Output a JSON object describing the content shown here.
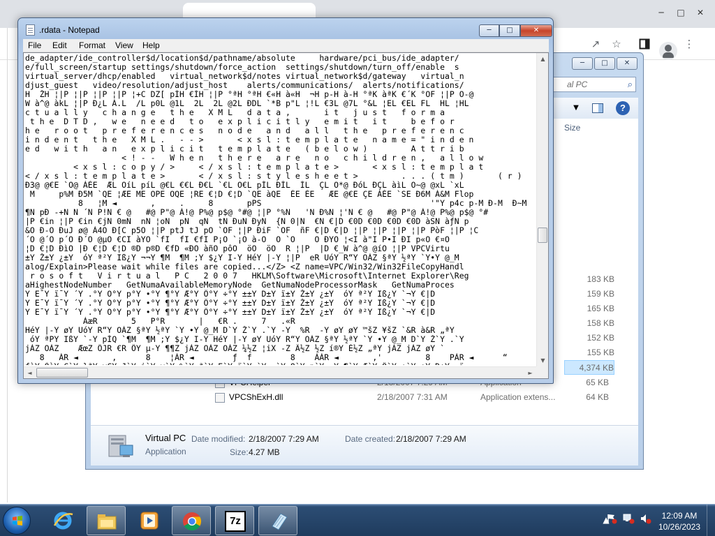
{
  "notepad": {
    "title": ".rdata - Notepad",
    "controls": {
      "minimize": "─",
      "maximize": "□",
      "close": "✕"
    },
    "menu": [
      "File",
      "Edit",
      "Format",
      "View",
      "Help"
    ],
    "lines": [
      "de_adapter/ide_controller$d/location$d/pathname/absolute     hardware/pci_bus/ide_adapter/",
      "e/full_screen/startup settings/shutdown/force_action  settings/shutdown/turn_off/enable  s",
      "virtual_server/dhcp/enabled   virtual_network$d/notes virtual_network$d/gateway   virtual_n",
      "djust_guest   video/resolution/adjust_host    alerts/communications/  alerts/notifications/",
      "H  ŽH ¦|P ¦|P ¦|P ¦|P ¦+C DZ[ pÍH €ÍH ¦|P °ªH °ªH €«H à«H  ¬H p-H à-H °ªK àªK €´K °OF ¦|P O-@",
      "W à^@ àkL ¦|P Đ¿L À.L  /L p0L @1L  2L  2L @2L ĐDL `*B p\"L ¦!L €3L @7L °&L ¦EL €EL FL  HL ¦HL",
      "c t u a l l y   c h a n g e   t h e   X M L   d a t a ,       i t   j u s t   f o r m a",
      " t h e  D T D ,   w e   n e e d   t o   e x p l i c i t l y   e m i t   i t     b e f o r",
      "h e   r o o t   p r e f e r e n c e s   n o d e   a n d   a l l   t h e   p r e f e r e n c",
      "i n d e n t   t h e   X M L .   - - >       < x s l : t e m p l a t e   n a m e = \" i n d e n",
      "e d   w i t h   a n   e x p l i c i t   t e m p l a t e   ( b e l o w )         A t t r i b",
      "                    < ! - -   W h e n   t h e r e   a r e   n o   c h i l d r e n ,   a l l o w",
      "          < x s l : c o p y / >     < / x s l : t e m p l a t e >       < x s l : t e m p l a t",
      "< / x s l : t e m p l a t e >       < / x s l : s t y l e s h e e t >         . . . ( t m )       ( r )   (",
      "Đ3@ @€E `O@ ÀÉE  ÆL OíL píL @€L €€L Đ€L `€L O€L pÍL ĐÍL  ÍL  ÇL O*@ ĐóL ĐÇL àìL O~@ @xL `xL",
      " M     p%M Đ5M `QE ¦ÆE ME OPE OQE ¦RE €¦D €¦D `QE àQE  ÉE ÉE   ÆE @€E ÇE ÀÉE `SE Đ6M À&M Flop",
      "           8   ¦M ◄       ,     .     8       pPS                                   '\"Y p4c p-M Đ-M  Đ~M ",
      "¶N pĐ -+N N ´N P!N € @   #@ P\"@ À!@ P%@ p$@ °#@ ¦|P °%N   'N Đ%N ¦'N € @   #@ P\"@ À!@ P%@ p$@ °#",
      "|P €in ¦|P €in €jN 0mN  nN ¦oN  pN  qN  tN ĐuN ĐyN  {N 0|N  €N €|D €0D €0D €0D €0D àSN àƒN p",
      "&O Đ-O ĐuJ ø@ À4O Đ[C p5O ¦|P ptJ tJ pO `OF ¦|P ĐiF `OF  ñF €|D €|D ¦|P ¦|P ¦|P ¦|P PòF ¦|P ¦C",
      "´O @´O p´O Đ´O @µO €CI àYO `fI  fI €fI P¡O `¡O à-O  O `O    O ÐYO ¦<I à\"I P•I ĐI p«O €¤O",
      "¦D €¦D ĐìO |Đ €¦D €¦D ®D p®D €fD «ĐO àñO pôO  öO  öO  R ¦|P  |D €_W à^@ @íO ¦|P VPCVirtu",
      "±Y Ž±Y ¿±Y  óY ª²Y Iß¿Y ¬¬Y ¶M  ¶M ;Y $¿Y I-Y HéY |-Y ¦|P  eR UóY R“Y OÀZ §ªY ½ªY `Y•Y @_M ",
      "alog/Explain>Please wait while files are copied...</Z> <Z name=VPC/Win32/Win32FileCopyHandl",
      " r o s o f t   V i r t u a l   P C   2 0 0 7   HKLM\\Software\\Microsoft\\Internet Explorer\\Reg",
      "aHighestNodeNumber   GetNumaAvailableMemoryNode  GetNumaNodeProcessorMask   GetNumaProces",
      "Y E¯Y ï¯Y ´Y .°Y O°Y p°Y •°Y ¶°Y Æ°Y Ö°Y ÷°Y ±±Y D±Y ï±Y Ž±Y ¿±Y  óY ª²Y Iß¿Y `¬Y €|D",
      "Y E¯Y ï¯Y ´Y .°Y O°Y p°Y •°Y ¶°Y Æ°Y Ö°Y ÷°Y ±±Y D±Y ï±Y Ž±Y ¿±Y  óY ª²Y Iß¿Y `¬Y €|D",
      "Y E¯Y ï¯Y ´Y .°Y O°Y p°Y •°Y ¶°Y Æ°Y Ö°Y ÷°Y ±±Y D±Y ï±Y Ž±Y ¿±Y  óY ª²Y Iß¿Y `¬Y €|D",
      "            ÀæR       5   P°R       |   €R .     7   .«R ",
      "HéY |-Y øY UóY R“Y OÀZ §ªY ½ªY `Y •Y @_M D`Y Ž`Y .`Y -Y  %R  -Y øY øY ™šZ ¥šZ `&R à&R „ªY",
      " óY ªPY IßY `-Y pÍQ `¶M  ¶M ;Y $¿Y I-Y HéY |-Y øY UóY R“Y OÀZ §ªY ½ªY `Y •Y @_M D`Y Ž`Y .`Y",
      "jÀZ OÀZ    ÆœZ ÖJR €R ÖY µ-Y ¶¶Z jÀZ OÀZ OÀZ ¼½Z ¦iX -Z Ä½Z ½Z í®Y É½Z „ªY jÀZ jÀZ øY `",
      "   8   ÀR ◄       ,      8    ¦ÀR ◄        ƒ  f        8    ÀÀR ◄       ,'         8    PÀR ◄      “",
      "fòY ÒòY C`Y }ªY yÇY J`Y i`Y y`Y %`Y ª`Y E`Y ï`Y `Y .`Y O`Y p`Y •Y ¶`Y Æ`Y Ö`Y ÷`Y ±Y D±Y  ï"
    ]
  },
  "explorer": {
    "controls": {
      "minimize": "─",
      "maximize": "□",
      "close": "✕"
    },
    "search_placeholder": "al PC",
    "column_size": "Size",
    "sizes": [
      "183 KB",
      "159 KB",
      "165 KB",
      "158 KB",
      "152 KB",
      "155 KB",
      "4,374 KB"
    ],
    "rows": [
      {
        "name": "VPCHelper",
        "date": "2/18/2007 7:29 AM",
        "type": "Application",
        "size": "65 KB"
      },
      {
        "name": "VPCShExH.dll",
        "date": "2/18/2007 7:31 AM",
        "type": "Application extens...",
        "size": "64 KB"
      }
    ],
    "details": {
      "name": "Virtual PC",
      "type": "Application",
      "modified_label": "Date modified:",
      "modified_value": "2/18/2007 7:29 AM",
      "created_label": "Date created:",
      "created_value": "2/18/2007 7:29 AM",
      "size_label": "Size:",
      "size_value": "4.27 MB"
    }
  },
  "chrome": {
    "controls": {
      "minimize": "─",
      "maximize": "□",
      "close": "✕"
    }
  },
  "taskbar": {
    "time": "12:09 AM",
    "date": "10/26/2023",
    "apps": [
      "ie-icon",
      "explorer-icon",
      "media-player-icon",
      "chrome-icon",
      "7zip-icon",
      "notepad-icon"
    ],
    "seven_zip_label": "7z"
  }
}
